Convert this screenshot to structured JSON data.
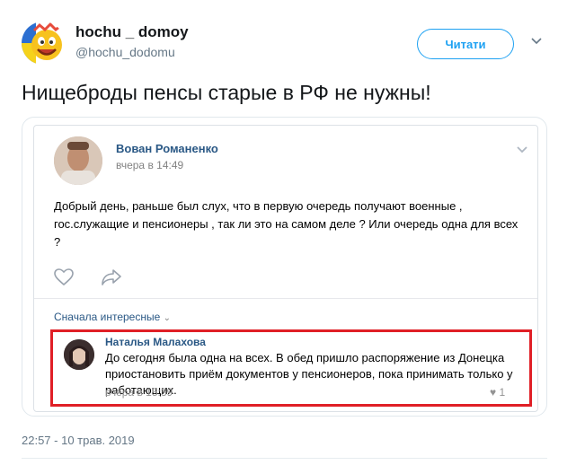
{
  "tweet": {
    "display_name": "hochu _ domoy",
    "handle": "@hochu_dodomu",
    "follow_label": "Читати",
    "text": "Нищеброды пенсы старые в РФ не нужны!",
    "timestamp": "22:57 - 10 трав. 2019"
  },
  "vk_post": {
    "author": "Вован Романенко",
    "date": "вчера в 14:49",
    "body": "Добрый день, раньше был слух, что в первую очередь получают военные , гос.служащие и пенсионеры , так ли это на самом деле ? Или очередь одна для всех ?",
    "sort_label": "Сначала интересные",
    "comment": {
      "author": "Наталья Малахова",
      "text": "До сегодня была одна на всех. В обед пришло распоряжение из Донецка приостановить приём документов у пенсионеров, пока принимать только у работающих.",
      "date": "вчера в 15:39",
      "likes": "1"
    }
  },
  "colors": {
    "twitter_blue": "#1da1f2",
    "vk_link": "#2a5885",
    "highlight_red": "#e01f26"
  }
}
